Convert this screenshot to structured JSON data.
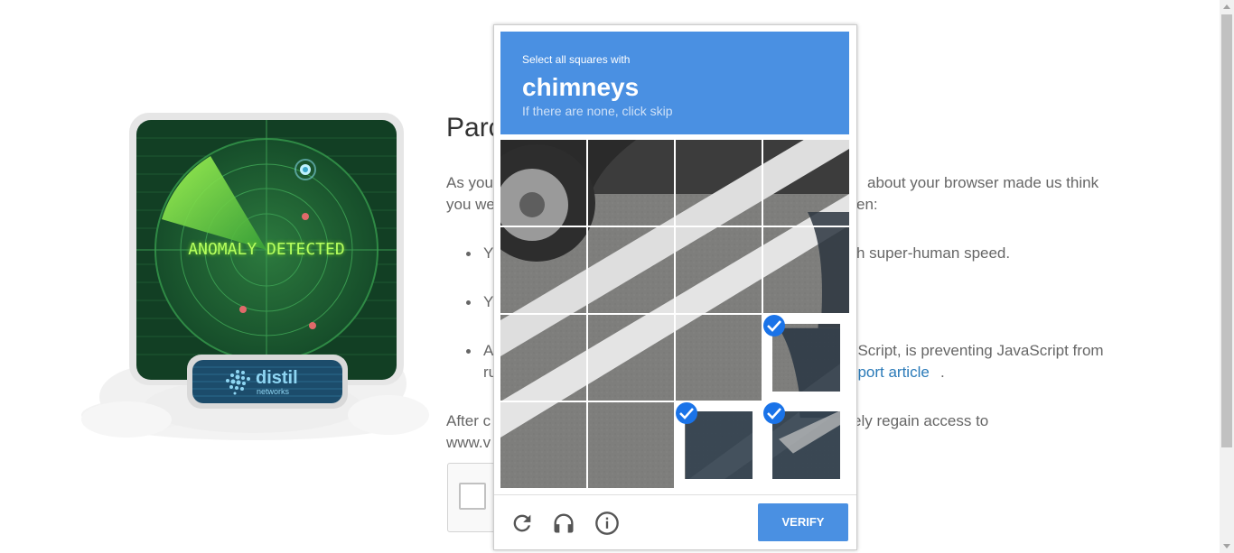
{
  "background_page": {
    "title_partial": "Parc",
    "paragraph_left": "As you",
    "paragraph_left_line2": "you we",
    "paragraph_right": "about your browser made us think",
    "paragraph_right_line2": "en:",
    "bullets": [
      {
        "left": "Y",
        "right": "h super-human speed."
      },
      {
        "left": "Y",
        "right": ""
      },
      {
        "left": "A",
        "left_line2": "ru",
        "right": "pScript, is preventing JavaScript from",
        "right_line2_link": "pport article",
        "right_line2_tail": "."
      }
    ],
    "after_left": "After c",
    "after_left_line2": "www.v",
    "after_right": "ely regain access to"
  },
  "illustration": {
    "screen_text": "ANOMALY DETECTED",
    "brand_name": "distil",
    "brand_sub": "networks"
  },
  "challenge": {
    "prompt_small": "Select all squares with",
    "prompt_object": "chimneys",
    "prompt_hint": "If there are none, click skip",
    "tiles": [
      {
        "row": 0,
        "col": 0,
        "selected": false
      },
      {
        "row": 0,
        "col": 1,
        "selected": false
      },
      {
        "row": 0,
        "col": 2,
        "selected": false
      },
      {
        "row": 0,
        "col": 3,
        "selected": false
      },
      {
        "row": 1,
        "col": 0,
        "selected": false
      },
      {
        "row": 1,
        "col": 1,
        "selected": false
      },
      {
        "row": 1,
        "col": 2,
        "selected": false
      },
      {
        "row": 1,
        "col": 3,
        "selected": false
      },
      {
        "row": 2,
        "col": 0,
        "selected": false
      },
      {
        "row": 2,
        "col": 1,
        "selected": false
      },
      {
        "row": 2,
        "col": 2,
        "selected": false
      },
      {
        "row": 2,
        "col": 3,
        "selected": true
      },
      {
        "row": 3,
        "col": 0,
        "selected": false
      },
      {
        "row": 3,
        "col": 1,
        "selected": false
      },
      {
        "row": 3,
        "col": 2,
        "selected": true
      },
      {
        "row": 3,
        "col": 3,
        "selected": true
      }
    ],
    "footer": {
      "reload_icon": "reload-icon",
      "audio_icon": "headphones-icon",
      "info_icon": "info-icon",
      "verify_label": "VERIFY"
    },
    "colors": {
      "accent": "#4a90e2",
      "check": "#1a73e8"
    }
  }
}
